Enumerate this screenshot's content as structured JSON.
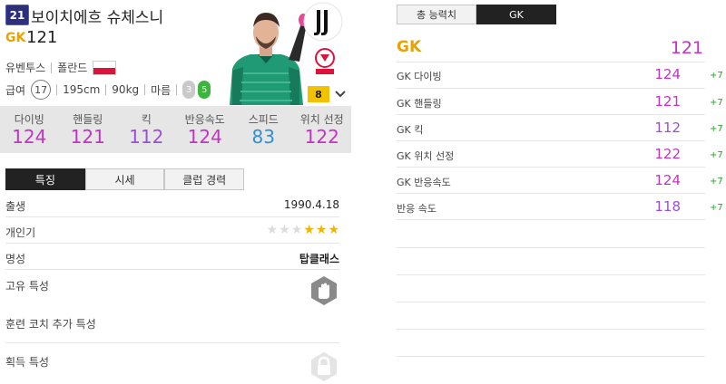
{
  "player": {
    "season_badge": "21",
    "name": "보이치에흐 슈체스니",
    "position": "GK",
    "ovr": "121",
    "club": "유벤투스",
    "nation": "폴란드",
    "pay_label": "급여",
    "pay": "17",
    "height": "195cm",
    "weight": "90kg",
    "body_type": "마름",
    "weak_foot": "3",
    "strong_foot": "5",
    "grade": "8"
  },
  "stats": [
    {
      "label": "다이빙",
      "value": "124",
      "color": "#c433c4"
    },
    {
      "label": "핸들링",
      "value": "121",
      "color": "#c433c4"
    },
    {
      "label": "킥",
      "value": "112",
      "color": "#9b4fd9"
    },
    {
      "label": "반응속도",
      "value": "124",
      "color": "#c433c4"
    },
    {
      "label": "스피드",
      "value": "83",
      "color": "#2f8fd6"
    },
    {
      "label": "위치 선정",
      "value": "122",
      "color": "#c433c4"
    }
  ],
  "tabs": [
    "특징",
    "시세",
    "클럽 경력"
  ],
  "details": {
    "birth_label": "출생",
    "birth_value": "1990.4.18",
    "popularity_label": "개인기",
    "popularity_stars_on": 3,
    "popularity_stars_total": 6,
    "reputation_label": "명성",
    "reputation_value": "탑클래스",
    "unique_trait_label": "고유 특성",
    "coach_trait_label": "훈련 코치 추가 특성",
    "acquired_trait_label": "획득 특성"
  },
  "right_tabs": [
    "총 능력치",
    "GK"
  ],
  "gk_panel": {
    "title": "GK",
    "value": "121",
    "rows": [
      {
        "label": "GK 다이빙",
        "value": "124",
        "bonus": "+7",
        "color": "#c433c4"
      },
      {
        "label": "GK 핸들링",
        "value": "121",
        "bonus": "+7",
        "color": "#c433c4"
      },
      {
        "label": "GK 킥",
        "value": "112",
        "bonus": "+7",
        "color": "#9b4fd9"
      },
      {
        "label": "GK 위치 선정",
        "value": "122",
        "bonus": "+7",
        "color": "#c433c4"
      },
      {
        "label": "GK 반응속도",
        "value": "124",
        "bonus": "+7",
        "color": "#c433c4"
      },
      {
        "label": "반응 속도",
        "value": "118",
        "bonus": "+7",
        "color": "#9b4fd9"
      }
    ]
  },
  "icons": {
    "club": "juventus-logo-icon",
    "nation": "poland-federation-icon",
    "unique_trait": "goalkeeper-glove-icon",
    "acquired_trait": "lock-icon",
    "grade_toggle": "chevron-down-icon"
  }
}
